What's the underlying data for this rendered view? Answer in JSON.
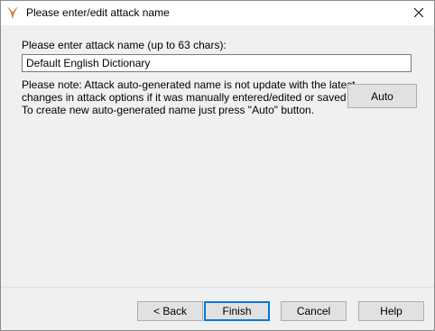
{
  "window": {
    "title": "Please enter/edit attack name",
    "app_icon": "passware-flame-icon",
    "close_icon": "close-icon"
  },
  "form": {
    "prompt": "Please enter attack name (up to 63 chars):",
    "name_value": "Default English Dictionary",
    "note_lines": [
      "Please note: Attack auto-generated name is not update with the latest",
      "changes in attack options if it was manually entered/edited or saved ones.",
      "To create new auto-generated name just press \"Auto\" button."
    ],
    "auto_label": "Auto"
  },
  "footer": {
    "back_label": "< Back",
    "finish_label": "Finish",
    "cancel_label": "Cancel",
    "help_label": "Help"
  },
  "colors": {
    "window_bg": "#f0f0f0",
    "titlebar_bg": "#ffffff",
    "icon_orange": "#e07b2a",
    "focus_blue": "#0078d7"
  }
}
